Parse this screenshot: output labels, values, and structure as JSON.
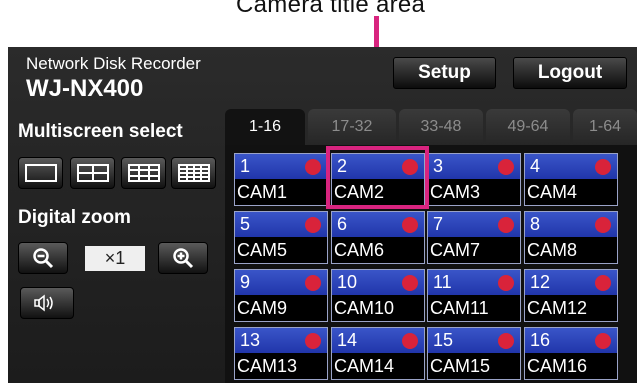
{
  "caption": "Camera title area",
  "app": {
    "brand_line1": "Network Disk Recorder",
    "brand_line2": "WJ-NX400"
  },
  "header": {
    "setup_label": "Setup",
    "logout_label": "Logout"
  },
  "sidebar": {
    "multiscreen_label": "Multiscreen select",
    "digital_zoom_label": "Digital zoom",
    "zoom_value": "×1",
    "icons": [
      "single-screen-icon",
      "quad-screen-icon",
      "nine-screen-icon",
      "sixteen-screen-icon",
      "zoom-out-icon",
      "zoom-in-icon",
      "speaker-icon"
    ]
  },
  "tabs": [
    {
      "label": "1-16",
      "active": true
    },
    {
      "label": "17-32",
      "active": false
    },
    {
      "label": "33-48",
      "active": false
    },
    {
      "label": "49-64",
      "active": false
    },
    {
      "label": "1-64",
      "active": false
    }
  ],
  "cameras": [
    {
      "num": "1",
      "name": "CAM1"
    },
    {
      "num": "2",
      "name": "CAM2"
    },
    {
      "num": "3",
      "name": "CAM3"
    },
    {
      "num": "4",
      "name": "CAM4"
    },
    {
      "num": "5",
      "name": "CAM5"
    },
    {
      "num": "6",
      "name": "CAM6"
    },
    {
      "num": "7",
      "name": "CAM7"
    },
    {
      "num": "8",
      "name": "CAM8"
    },
    {
      "num": "9",
      "name": "CAM9"
    },
    {
      "num": "10",
      "name": "CAM10"
    },
    {
      "num": "11",
      "name": "CAM11"
    },
    {
      "num": "12",
      "name": "CAM12"
    },
    {
      "num": "13",
      "name": "CAM13"
    },
    {
      "num": "14",
      "name": "CAM14"
    },
    {
      "num": "15",
      "name": "CAM15"
    },
    {
      "num": "16",
      "name": "CAM16"
    }
  ],
  "colors": {
    "callout": "#d8247f",
    "cell_blue": "#2a40b8",
    "status_dot": "#d9233a"
  }
}
